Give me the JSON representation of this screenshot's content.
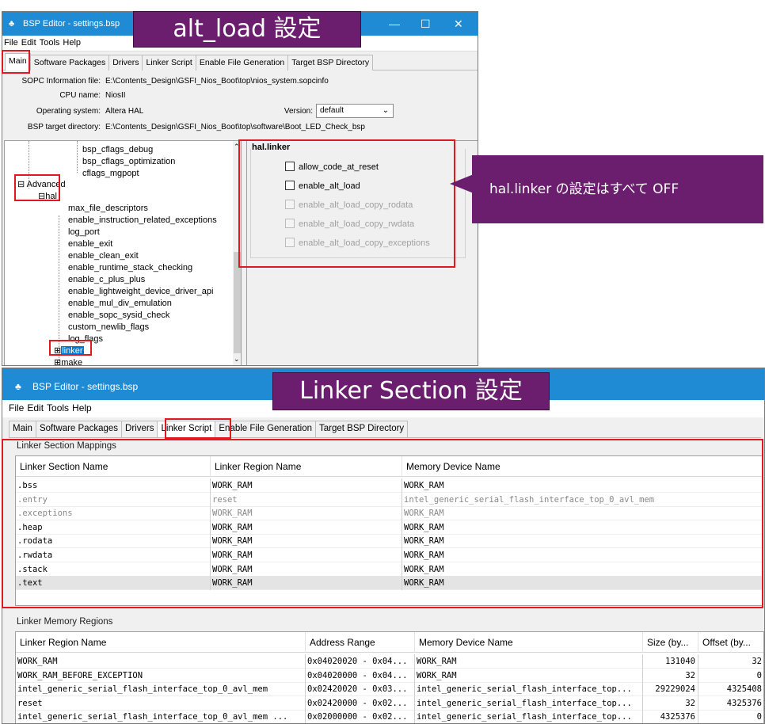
{
  "top_banner": "alt_load 設定",
  "bottom_banner": "Linker Section 設定",
  "callout": "hal.linker の設定はすべて OFF",
  "window1": {
    "title": "BSP Editor - settings.bsp",
    "menu": [
      "File",
      "Edit",
      "Tools",
      "Help"
    ],
    "tabs": [
      "Main",
      "Software Packages",
      "Drivers",
      "Linker Script",
      "Enable File Generation",
      "Target BSP Directory"
    ],
    "info": {
      "sopc_label": "SOPC Information file:",
      "sopc_value": "E:\\Contents_Design\\GSFI_Nios_Boot\\top\\nios_system.sopcinfo",
      "cpu_label": "CPU name:",
      "cpu_value": "NiosII",
      "os_label": "Operating system:",
      "os_value": "Altera HAL",
      "version_label": "Version:",
      "version_value": "default",
      "bsp_label": "BSP target directory:",
      "bsp_value": "E:\\Contents_Design\\GSFI_Nios_Boot\\top\\software\\Boot_LED_Check_bsp"
    },
    "tree": {
      "top_items": [
        "bsp_cflags_debug",
        "bsp_cflags_optimization",
        "cflags_mgpopt"
      ],
      "advanced": "Advanced",
      "hal": "hal",
      "hal_items": [
        "max_file_descriptors",
        "enable_instruction_related_exceptions",
        "log_port",
        "enable_exit",
        "enable_clean_exit",
        "enable_runtime_stack_checking",
        "enable_c_plus_plus",
        "enable_lightweight_device_driver_api",
        "enable_mul_div_emulation",
        "enable_sopc_sysid_check",
        "custom_newlib_flags",
        "log_flags"
      ],
      "linker": "linker",
      "make": "make"
    },
    "panel": {
      "title": "hal.linker",
      "checkboxes": [
        {
          "label": "allow_code_at_reset",
          "enabled": true
        },
        {
          "label": "enable_alt_load",
          "enabled": true
        },
        {
          "label": "enable_alt_load_copy_rodata",
          "enabled": false
        },
        {
          "label": "enable_alt_load_copy_rwdata",
          "enabled": false
        },
        {
          "label": "enable_alt_load_copy_exceptions",
          "enabled": false
        }
      ]
    }
  },
  "window2": {
    "title": "BSP Editor - settings.bsp",
    "menu": [
      "File",
      "Edit",
      "Tools",
      "Help"
    ],
    "tabs": [
      "Main",
      "Software Packages",
      "Drivers",
      "Linker Script",
      "Enable File Generation",
      "Target BSP Directory"
    ],
    "mappings": {
      "title": "Linker Section Mappings",
      "headers": [
        "Linker Section Name",
        "Linker Region Name",
        "Memory Device Name"
      ],
      "rows": [
        {
          "name": ".bss",
          "region": "WORK_RAM",
          "device": "WORK_RAM",
          "dim": false
        },
        {
          "name": ".entry",
          "region": "reset",
          "device": "intel_generic_serial_flash_interface_top_0_avl_mem",
          "dim": true
        },
        {
          "name": ".exceptions",
          "region": "WORK_RAM",
          "device": "WORK_RAM",
          "dim": true
        },
        {
          "name": ".heap",
          "region": "WORK_RAM",
          "device": "WORK_RAM",
          "dim": false
        },
        {
          "name": ".rodata",
          "region": "WORK_RAM",
          "device": "WORK_RAM",
          "dim": false
        },
        {
          "name": ".rwdata",
          "region": "WORK_RAM",
          "device": "WORK_RAM",
          "dim": false
        },
        {
          "name": ".stack",
          "region": "WORK_RAM",
          "device": "WORK_RAM",
          "dim": false
        },
        {
          "name": ".text",
          "region": "WORK_RAM",
          "device": "WORK_RAM",
          "dim": false
        }
      ]
    },
    "regions": {
      "title": "Linker Memory Regions",
      "headers": [
        "Linker Region Name",
        "Address Range",
        "Memory Device Name",
        "Size (by...",
        "Offset (by..."
      ],
      "rows": [
        {
          "name": "WORK_RAM",
          "range": "0x04020020 - 0x04...",
          "device": "WORK_RAM",
          "size": "131040",
          "offset": "32"
        },
        {
          "name": "WORK_RAM_BEFORE_EXCEPTION",
          "range": "0x04020000 - 0x04...",
          "device": "WORK_RAM",
          "size": "32",
          "offset": "0"
        },
        {
          "name": "intel_generic_serial_flash_interface_top_0_avl_mem",
          "range": "0x02420020 - 0x03...",
          "device": "intel_generic_serial_flash_interface_top...",
          "size": "29229024",
          "offset": "4325408"
        },
        {
          "name": "reset",
          "range": "0x02420000 - 0x02...",
          "device": "intel_generic_serial_flash_interface_top...",
          "size": "32",
          "offset": "4325376"
        },
        {
          "name": "intel_generic_serial_flash_interface_top_0_avl_mem ...",
          "range": "0x02000000 - 0x02...",
          "device": "intel_generic_serial_flash_interface_top...",
          "size": "4325376",
          "offset": "0"
        }
      ]
    }
  },
  "colors": {
    "titlebar": "#1e8bd4",
    "banner": "#6b1e6e",
    "highlight_box": "#e0181f",
    "selection": "#0078d7"
  }
}
